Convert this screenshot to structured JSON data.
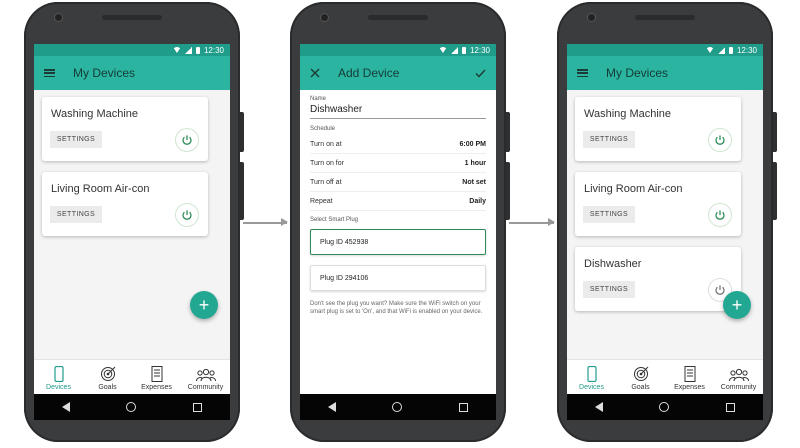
{
  "status": {
    "time": "12:30"
  },
  "screen1": {
    "title": "My Devices",
    "devices": [
      {
        "name": "Washing Machine",
        "settings": "SETTINGS"
      },
      {
        "name": "Living Room Air-con",
        "settings": "SETTINGS"
      }
    ],
    "fab": "+"
  },
  "screen2": {
    "title": "Add Device",
    "name_label": "Name",
    "name_value": "Dishwasher",
    "schedule_label": "Schedule",
    "rows": [
      {
        "label": "Turn on at",
        "value": "6:00 PM"
      },
      {
        "label": "Turn on for",
        "value": "1 hour"
      },
      {
        "label": "Turn off at",
        "value": "Not set"
      },
      {
        "label": "Repeat",
        "value": "Daily"
      }
    ],
    "select_label": "Select Smart Plug",
    "plugs": [
      "Plug ID 452938",
      "Plug ID 294106"
    ],
    "hint": "Don't see the plug you want? Make sure the WiFi switch on your smart plug is set to 'On', and that WiFi is enabled on your device."
  },
  "screen3": {
    "title": "My Devices",
    "devices": [
      {
        "name": "Washing Machine",
        "settings": "SETTINGS"
      },
      {
        "name": "Living Room Air-con",
        "settings": "SETTINGS"
      },
      {
        "name": "Dishwasher",
        "settings": "SETTINGS"
      }
    ],
    "fab": "+"
  },
  "nav": [
    "Devices",
    "Goals",
    "Expenses",
    "Community"
  ],
  "colors": {
    "accent": "#2bb5a0",
    "statusbar": "#1f9c8a",
    "fab": "#22a892",
    "power": "#2e8b57"
  },
  "icons": [
    "menu-icon",
    "power-icon",
    "plus-icon",
    "close-icon",
    "check-icon",
    "phone-icon",
    "target-icon",
    "receipt-icon",
    "people-icon"
  ]
}
